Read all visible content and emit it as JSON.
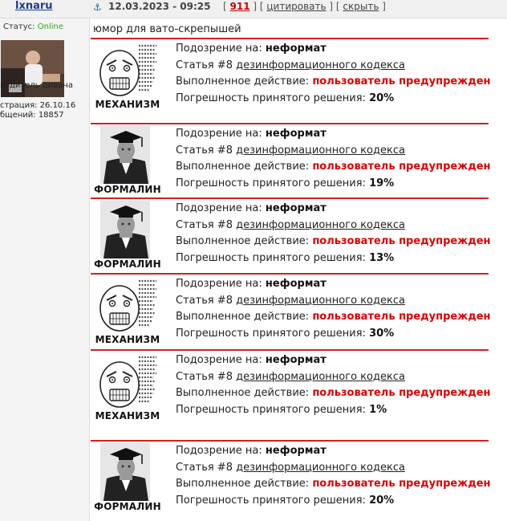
{
  "header": {
    "username": "lxnaru",
    "date": "12.03.2023 - 09:25",
    "open1": "[ ",
    "post_number": "911",
    "sep1": " ] [ ",
    "quote_label": "цитировать",
    "sep2": " ] [ ",
    "hide_label": "скрыть",
    "close": " ]"
  },
  "sidebar": {
    "status_label": "Статус: ",
    "status_value": "Online",
    "user_title": "водитель дивана",
    "registered": "страция: 26.10.16",
    "messages": "бщений: 18857"
  },
  "post_text": "юмор для вато-скрепышей",
  "labels": {
    "suspicion": "Подозрение на: ",
    "article_prefix": "Статья #8 ",
    "article_link": "дезинформационного кодекса",
    "action": "Выполненное действие: ",
    "error": "Погрешность принятого решения: "
  },
  "cards": [
    {
      "name": "МЕХАНИЗМ",
      "image": "rage-face-icon",
      "suspicion_value": "неформат",
      "action_value": "пользователь предупрежден",
      "error_value": "20%"
    },
    {
      "name": "ФОРМАЛИН",
      "image": "graduate-icon",
      "suspicion_value": "неформат",
      "action_value": "пользователь предупрежден",
      "error_value": "19%"
    },
    {
      "name": "ФОРМАЛИН",
      "image": "graduate-icon",
      "suspicion_value": "неформат",
      "action_value": "пользователь предупрежден",
      "error_value": "13%"
    },
    {
      "name": "МЕХАНИЗМ",
      "image": "rage-face-icon",
      "suspicion_value": "неформат",
      "action_value": "пользователь предупрежден",
      "error_value": "30%"
    },
    {
      "name": "МЕХАНИЗМ",
      "image": "rage-face-icon",
      "suspicion_value": "неформат",
      "action_value": "пользователь предупрежден",
      "error_value": "1%"
    },
    {
      "name": "ФОРМАЛИН",
      "image": "graduate-icon",
      "suspicion_value": "неформат",
      "action_value": "пользователь предупрежден",
      "error_value": "20%"
    }
  ],
  "colors": {
    "accent_red": "#d42020",
    "online_green": "#33a11f",
    "link_blue": "#1d3c8a"
  }
}
